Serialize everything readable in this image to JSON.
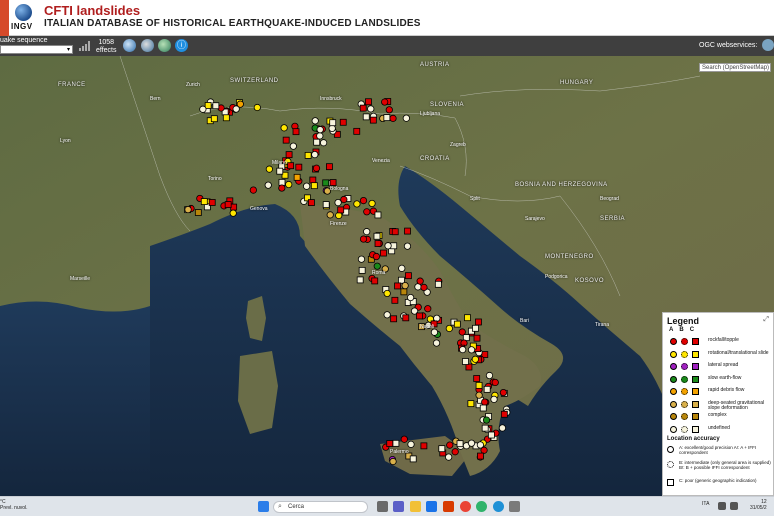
{
  "header": {
    "logo_text": "INGV",
    "title": "CFTI landslides",
    "subtitle": "ITALIAN DATABASE OF HISTORICAL EARTHQUAKE-INDUCED LANDSLIDES"
  },
  "toolbar": {
    "select_value": "uake sequence",
    "effects_count": "1058",
    "effects_label": "effects",
    "ogc_label": "OGC webservices:"
  },
  "map": {
    "search_placeholder": "Search (OpenStreetMap)",
    "country_labels": [
      "FRANCE",
      "SWITZERLAND",
      "AUSTRIA",
      "HUNGARY",
      "SLOVENIA",
      "CROATIA",
      "BOSNIA AND HERZEGOVINA",
      "SERBIA",
      "MONTENEGRO",
      "KOSOVO"
    ],
    "city_labels": [
      "Milano",
      "Torino",
      "Genova",
      "Venezia",
      "Bologna",
      "Firenze",
      "Roma",
      "Napoli",
      "Bari",
      "Palermo",
      "Zagreb",
      "Sarajevo",
      "Beograd",
      "Ljubljana",
      "Marseille",
      "Lyon",
      "Zurich",
      "Bern",
      "Innsbruck",
      "Podgorica",
      "Tirana",
      "Split"
    ]
  },
  "legend": {
    "title": "Legend",
    "expand_icon": "expand-icon",
    "columns": [
      "A",
      "B",
      "C"
    ],
    "types": [
      {
        "label": "rockfall/topple",
        "color": "#e00000"
      },
      {
        "label": "rotational/translational slide",
        "color": "#ffe600"
      },
      {
        "label": "lateral spread",
        "color": "#a020c0"
      },
      {
        "label": "slow earth-flow",
        "color": "#1a8a1a"
      },
      {
        "label": "rapid debris flow",
        "color": "#f4a300"
      },
      {
        "label": "deep-seated gravitational slope deformation",
        "color": "#d9b04a"
      },
      {
        "label": "complex",
        "color": "#b8860b"
      },
      {
        "label": "undefined",
        "color": "#f6f3dc"
      }
    ],
    "accuracy_title": "Location accuracy",
    "accuracy": [
      {
        "label": "A: excellent/good precision   A!: A + IFFI correspondent"
      },
      {
        "label": "B: intermediate (only general area is supplied)   B!: B + possible IFFI correspondent"
      },
      {
        "label": "C: poor (generic geographic indication)"
      }
    ]
  },
  "taskbar": {
    "weather_temp": "°C",
    "weather_desc": "Prevl. nuvol.",
    "search_label": "Cerca",
    "lang": "ITA",
    "time": "12",
    "date": "31/05/2"
  }
}
